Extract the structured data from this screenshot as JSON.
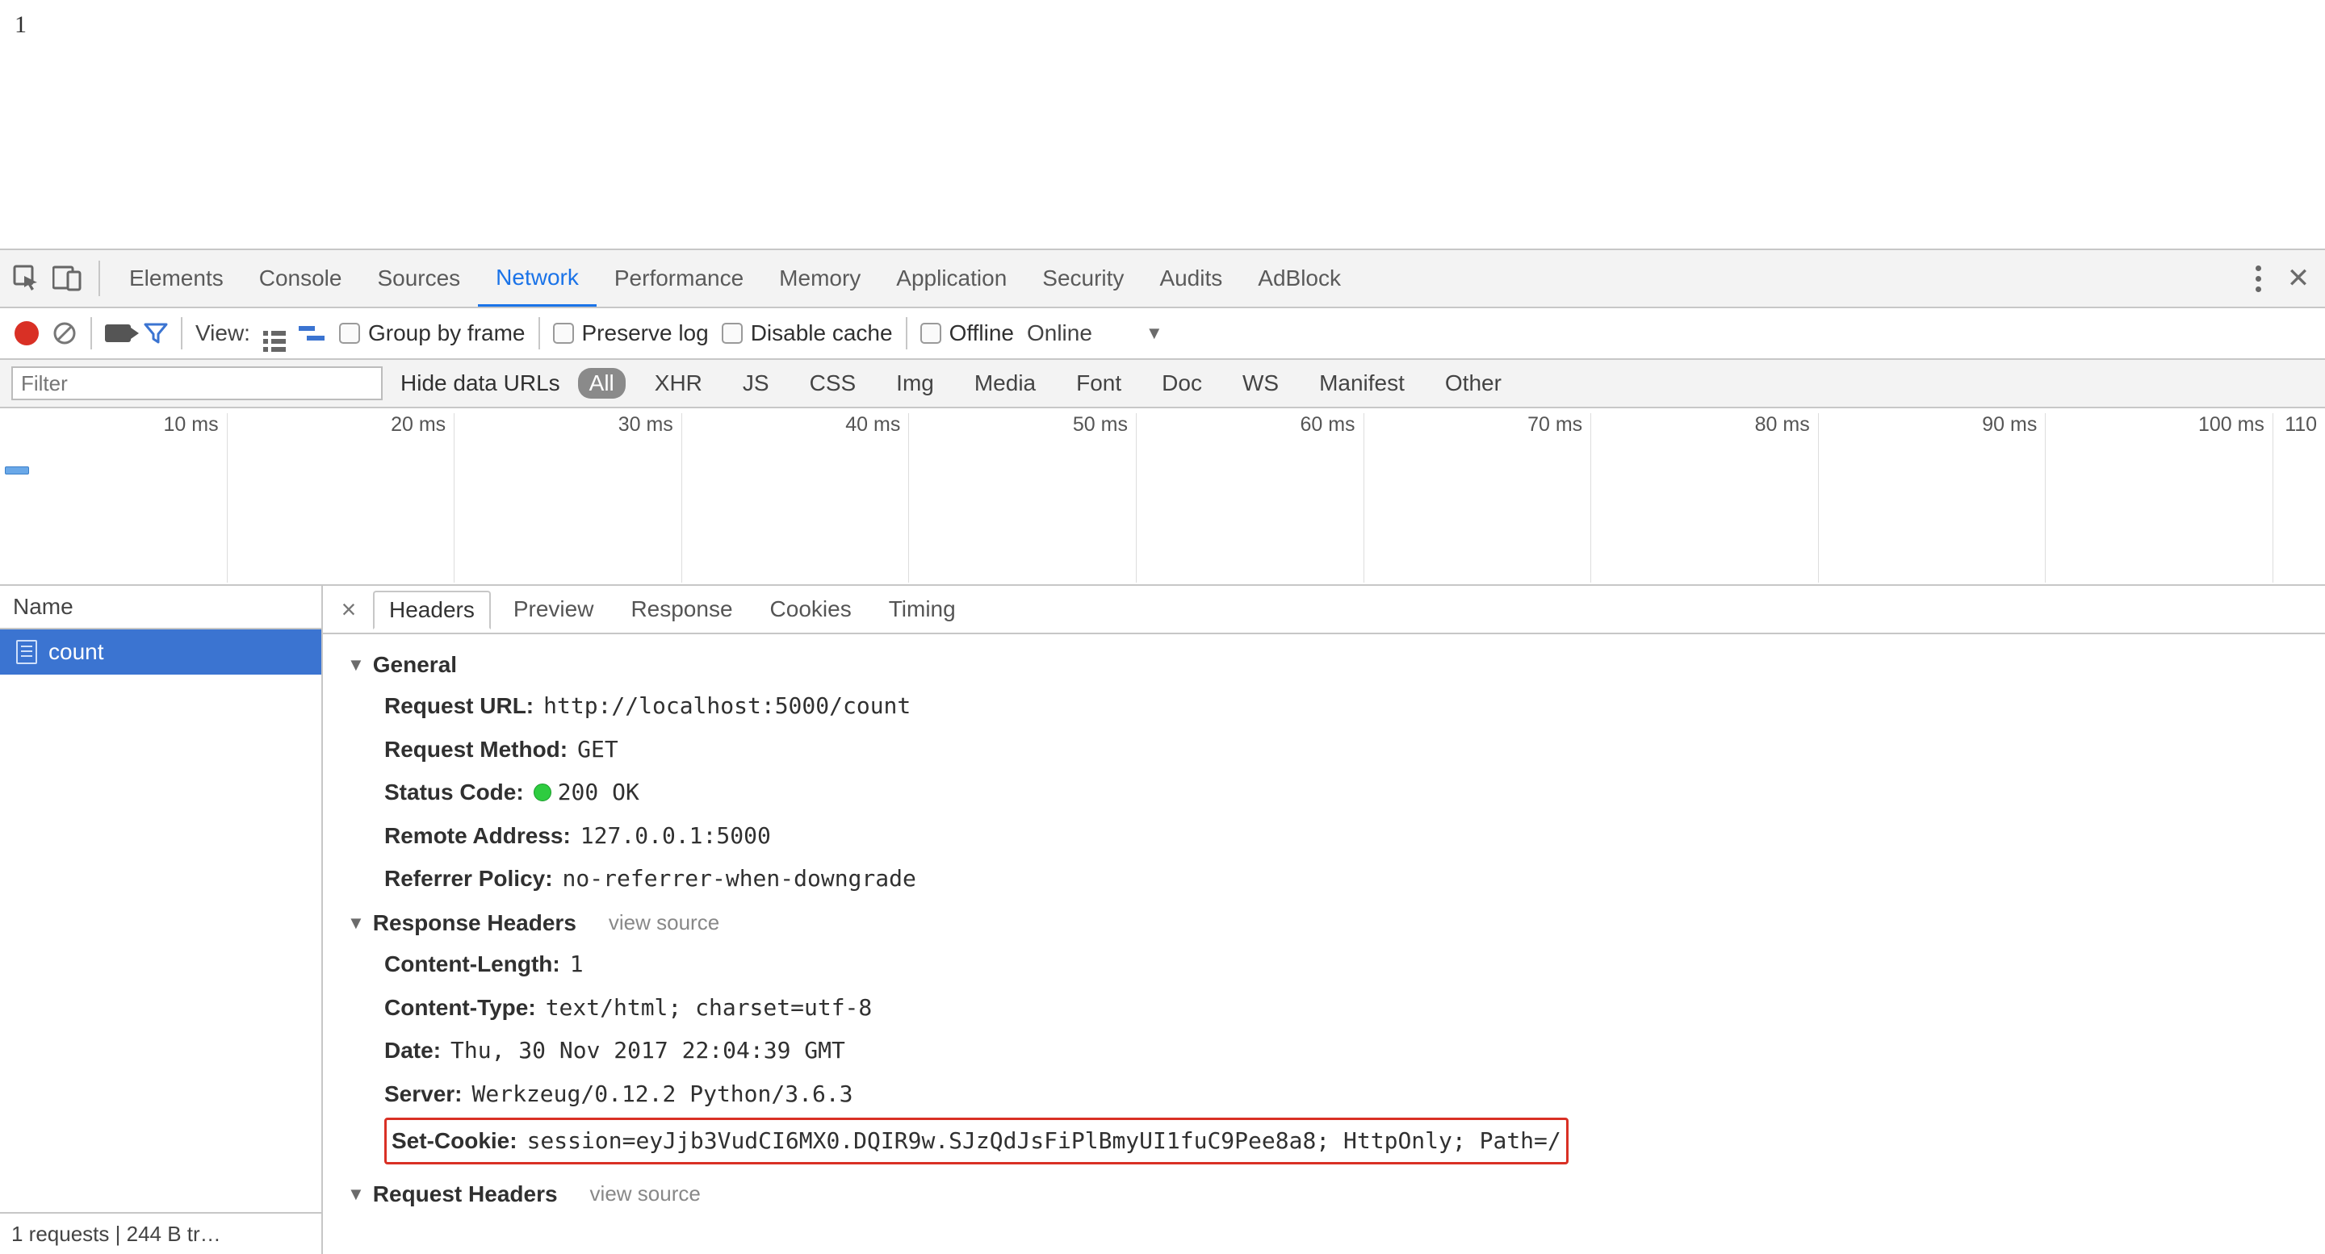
{
  "page": {
    "body_text": "1"
  },
  "tabs": {
    "items": [
      "Elements",
      "Console",
      "Sources",
      "Network",
      "Performance",
      "Memory",
      "Application",
      "Security",
      "Audits",
      "AdBlock"
    ],
    "active_index": 3
  },
  "toolbar": {
    "view_label": "View:",
    "group_by_frame": "Group by frame",
    "preserve_log": "Preserve log",
    "disable_cache": "Disable cache",
    "offline": "Offline",
    "online": "Online"
  },
  "filterbar": {
    "placeholder": "Filter",
    "hide_data_urls": "Hide data URLs",
    "types": [
      "All",
      "XHR",
      "JS",
      "CSS",
      "Img",
      "Media",
      "Font",
      "Doc",
      "WS",
      "Manifest",
      "Other"
    ],
    "active_index": 0
  },
  "timeline": {
    "ticks": [
      "10 ms",
      "20 ms",
      "30 ms",
      "40 ms",
      "50 ms",
      "60 ms",
      "70 ms",
      "80 ms",
      "90 ms",
      "100 ms",
      "110"
    ]
  },
  "request_list": {
    "header": "Name",
    "items": [
      "count"
    ],
    "selected_index": 0,
    "status": "1 requests | 244 B tr…"
  },
  "detail": {
    "tabs": [
      "Headers",
      "Preview",
      "Response",
      "Cookies",
      "Timing"
    ],
    "active_index": 0,
    "general": {
      "title": "General",
      "request_url": {
        "k": "Request URL:",
        "v": "http://localhost:5000/count"
      },
      "request_method": {
        "k": "Request Method:",
        "v": "GET"
      },
      "status_code": {
        "k": "Status Code:",
        "v": "200 OK"
      },
      "remote_address": {
        "k": "Remote Address:",
        "v": "127.0.0.1:5000"
      },
      "referrer_policy": {
        "k": "Referrer Policy:",
        "v": "no-referrer-when-downgrade"
      }
    },
    "response_headers": {
      "title": "Response Headers",
      "view_source": "view source",
      "content_length": {
        "k": "Content-Length:",
        "v": "1"
      },
      "content_type": {
        "k": "Content-Type:",
        "v": "text/html; charset=utf-8"
      },
      "date": {
        "k": "Date:",
        "v": "Thu, 30 Nov 2017 22:04:39 GMT"
      },
      "server": {
        "k": "Server:",
        "v": "Werkzeug/0.12.2 Python/3.6.3"
      },
      "set_cookie": {
        "k": "Set-Cookie:",
        "v": "session=eyJjb3VudCI6MX0.DQIR9w.SJzQdJsFiPlBmyUI1fuC9Pee8a8; HttpOnly; Path=/"
      }
    },
    "request_headers": {
      "title": "Request Headers",
      "view_source": "view source"
    }
  }
}
